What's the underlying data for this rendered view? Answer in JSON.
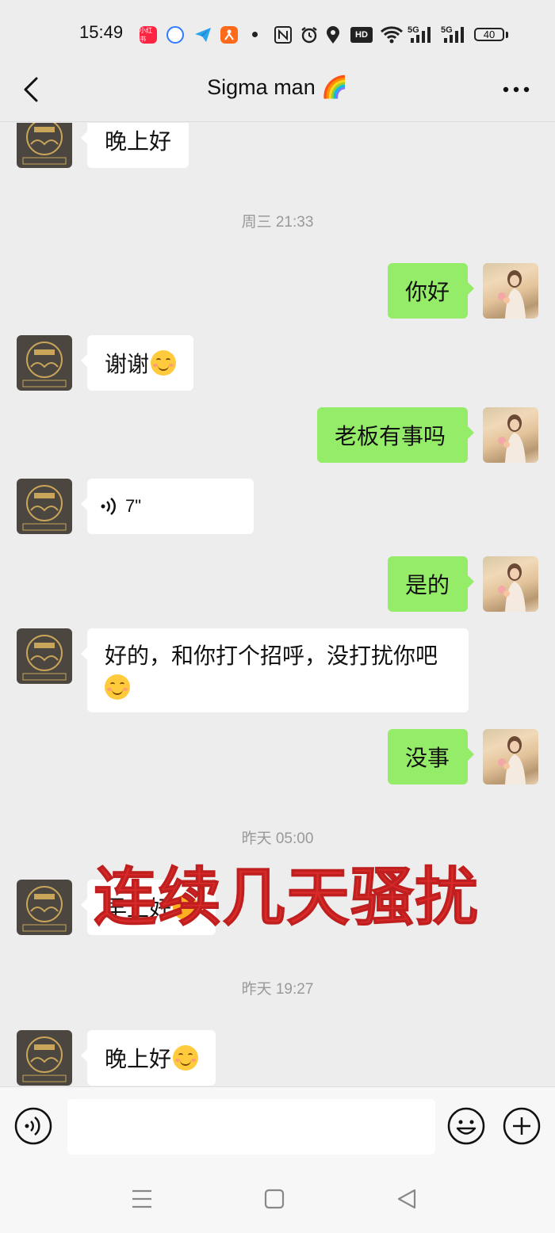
{
  "status_bar": {
    "time": "15:49",
    "app_icons": [
      {
        "name": "xiaohongshu-app-icon",
        "label": "小红书",
        "color": "#ff2442"
      },
      {
        "name": "browser-app-icon",
        "label": "",
        "color": "#2f7bff"
      },
      {
        "name": "paper-plane-app-icon",
        "label": "",
        "color": "#2aa3ef"
      },
      {
        "name": "jingdong-app-icon",
        "label": "",
        "color": "#ff6a1a"
      }
    ],
    "battery": "40",
    "network_label": "5G"
  },
  "header": {
    "title": "Sigma man 🌈"
  },
  "colors": {
    "sent_bubble": "#95ec69",
    "received_bubble": "#ffffff",
    "background": "#ededed",
    "overlay_text": "#d92a2a"
  },
  "messages": {
    "m0": {
      "text": "晚上好"
    },
    "ts1": "周三 21:33",
    "m1": {
      "text": "你好"
    },
    "m2": {
      "text": "谢谢"
    },
    "m3": {
      "text": "老板有事吗"
    },
    "m4": {
      "duration": "7\""
    },
    "m5": {
      "text": "是的"
    },
    "m6": {
      "line1": "好的，和你打个招呼，没打扰你吧"
    },
    "m7": {
      "text": "没事"
    },
    "ts2": "昨天 05:00",
    "m8": {
      "text": "早上好"
    },
    "ts3": "昨天 19:27",
    "m9": {
      "text": "晚上好"
    }
  },
  "overlay_caption": "连续几天骚扰",
  "input": {
    "value": "",
    "placeholder": ""
  }
}
